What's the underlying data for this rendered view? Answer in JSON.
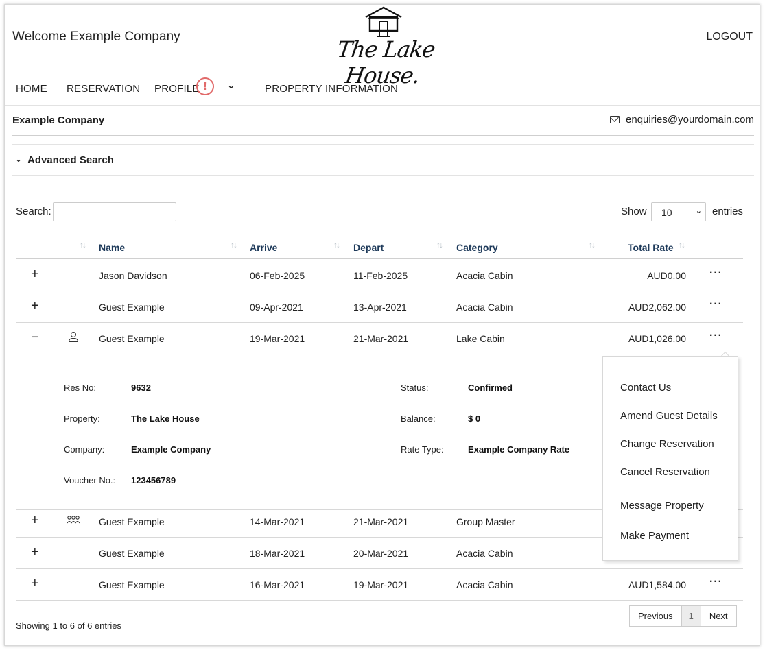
{
  "header": {
    "welcome": "Welcome Example Company",
    "logo_text": "The Lake House.",
    "logout": "LOGOUT"
  },
  "nav": {
    "items": [
      "HOME",
      "RESERVATION",
      "PROFILE",
      "PROPERTY INFORMATION"
    ],
    "profile_alert": "!"
  },
  "company": {
    "name": "Example Company",
    "email": "enquiries@yourdomain.com"
  },
  "advanced_search": {
    "label": "Advanced Search"
  },
  "search": {
    "label": "Search:",
    "value": ""
  },
  "length": {
    "show": "Show",
    "value": "10",
    "entries": "entries"
  },
  "table": {
    "columns": [
      "Name",
      "Arrive",
      "Depart",
      "Category",
      "Total Rate"
    ],
    "rows": [
      {
        "toggle": "+",
        "icon": "",
        "name": "Jason Davidson",
        "arrive": "06-Feb-2025",
        "depart": "11-Feb-2025",
        "category": "Acacia Cabin",
        "rate": "AUD0.00"
      },
      {
        "toggle": "+",
        "icon": "",
        "name": "Guest Example",
        "arrive": "09-Apr-2021",
        "depart": "13-Apr-2021",
        "category": "Acacia Cabin",
        "rate": "AUD2,062.00"
      },
      {
        "toggle": "−",
        "icon": "person-icon",
        "name": "Guest Example",
        "arrive": "19-Mar-2021",
        "depart": "21-Mar-2021",
        "category": "Lake Cabin",
        "rate": "AUD1,026.00"
      },
      {
        "toggle": "+",
        "icon": "group-icon",
        "name": "Guest Example",
        "arrive": "14-Mar-2021",
        "depart": "21-Mar-2021",
        "category": "Group Master",
        "rate": ""
      },
      {
        "toggle": "+",
        "icon": "",
        "name": "Guest Example",
        "arrive": "18-Mar-2021",
        "depart": "20-Mar-2021",
        "category": "Acacia Cabin",
        "rate": ""
      },
      {
        "toggle": "+",
        "icon": "",
        "name": "Guest Example",
        "arrive": "16-Mar-2021",
        "depart": "19-Mar-2021",
        "category": "Acacia Cabin",
        "rate": "AUD1,584.00"
      }
    ]
  },
  "detail": {
    "res_no_label": "Res No:",
    "res_no": "9632",
    "property_label": "Property:",
    "property": "The Lake House",
    "company_label": "Company:",
    "company": "Example Company",
    "voucher_label": "Voucher No.:",
    "voucher": "123456789",
    "status_label": "Status:",
    "status": "Confirmed",
    "balance_label": "Balance:",
    "balance": "$ 0",
    "rate_type_label": "Rate Type:",
    "rate_type": "Example Company Rate"
  },
  "menu": {
    "items": [
      "Contact Us",
      "Amend Guest Details",
      "Change Reservation",
      "Cancel Reservation",
      "Message Property",
      "Make Payment"
    ]
  },
  "footer": {
    "showing": "Showing 1 to 6 of 6 entries",
    "prev": "Previous",
    "page": "1",
    "next": "Next"
  }
}
